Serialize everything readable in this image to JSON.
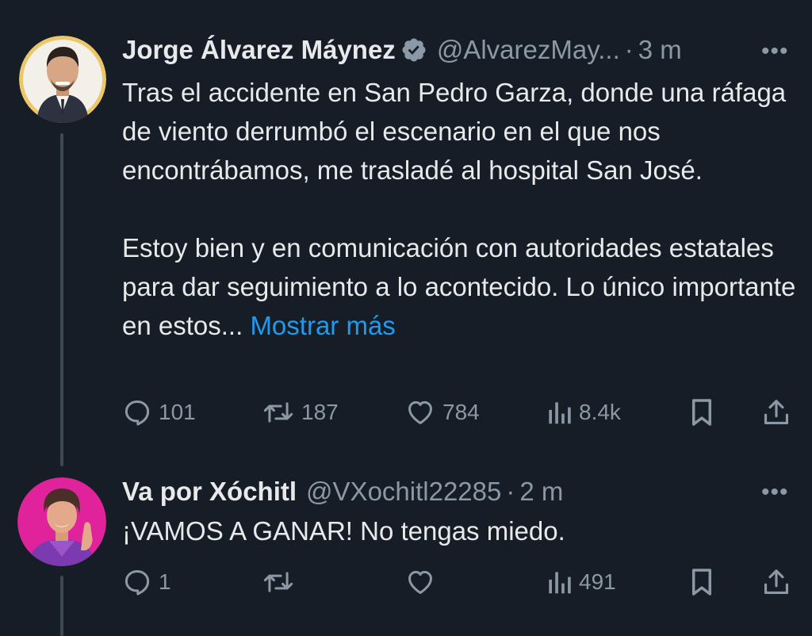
{
  "colors": {
    "background": "#161d26",
    "text": "#e7e9ea",
    "secondary": "#8b98a5",
    "link": "#1d9bf0",
    "thread_line": "#3e4852"
  },
  "tweet1": {
    "name": "Jorge Álvarez Máynez",
    "verified_icon": "verified-badge-icon",
    "handle": "@AlvarezMay...",
    "separator": "·",
    "time": "3 m",
    "more": "•••",
    "paragraph1": "Tras el accidente en San Pedro Garza, donde una ráfaga de viento derrumbó el escenario en el que nos encontrábamos, me trasladé al hospital San José.",
    "paragraph2": "Estoy bien y en comunicación con autoridades estatales para dar seguimiento a lo acontecido. Lo único importante en estos...",
    "show_more": "Mostrar más",
    "replies": "101",
    "retweets": "187",
    "likes": "784",
    "views": "8.4k"
  },
  "tweet2": {
    "name": "Va por Xóchitl",
    "handle": "@VXochitl22285",
    "separator": "·",
    "time": "2 m",
    "more": "•••",
    "text": "¡VAMOS A GANAR! No tengas miedo.",
    "replies": "1",
    "retweets": "",
    "likes": "",
    "views": "491"
  }
}
